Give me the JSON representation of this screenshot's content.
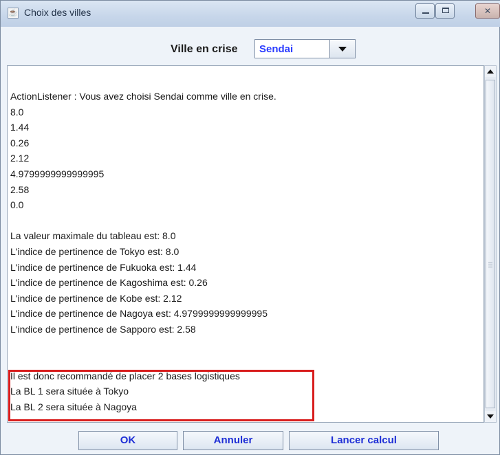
{
  "window": {
    "title": "Choix des villes",
    "icon": "java-cup-icon"
  },
  "top": {
    "label": "Ville en crise",
    "combo_value": "Sendai"
  },
  "log_lines": [
    "ActionListener : Vous avez choisi Sendai comme ville en crise.",
    "8.0",
    "1.44",
    "0.26",
    "2.12",
    "4.9799999999999995",
    "2.58",
    "0.0",
    "",
    "La valeur maximale du tableau est: 8.0",
    "L'indice de pertinence de Tokyo est: 8.0",
    "L'indice de pertinence de Fukuoka est: 1.44",
    "L'indice de pertinence de Kagoshima est: 0.26",
    "L'indice de pertinence de Kobe est: 2.12",
    "L'indice de pertinence de Nagoya est: 4.9799999999999995",
    "L'indice de pertinence de Sapporo est: 2.58",
    "",
    "",
    "Il est donc recommandé de placer 2 bases logistiques",
    "La BL 1 sera située à Tokyo",
    "La BL 2 sera située à Nagoya"
  ],
  "buttons": {
    "ok": "OK",
    "annuler": "Annuler",
    "calcul": "Lancer calcul"
  },
  "colors": {
    "highlight_border": "#d81d1d",
    "button_text": "#1f2fd6",
    "combo_text": "#2b3cff"
  }
}
